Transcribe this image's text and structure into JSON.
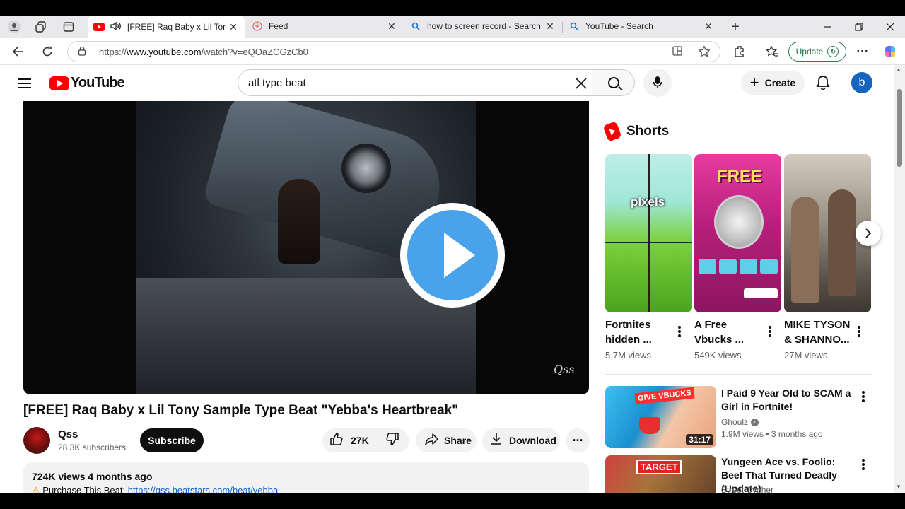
{
  "browser": {
    "tabs": [
      {
        "title": "[FREE] Raq Baby x Lil Tony Sa",
        "active": true
      },
      {
        "title": "Feed"
      },
      {
        "title": "how to screen record - Search"
      },
      {
        "title": "YouTube - Search"
      }
    ],
    "url_prefix": "https://",
    "url_host": "www.youtube.com",
    "url_path": "/watch?v=eQOaZCGzCb0",
    "update_label": "Update",
    "new_tab": "+"
  },
  "youtube": {
    "logo_text": "YouTube",
    "search_query": "atl type beat",
    "create_label": "Create",
    "avatar_letter": "b"
  },
  "video": {
    "title": "[FREE] Raq Baby x Lil Tony Sample Type Beat \"Yebba's Heartbreak\"",
    "watermark": "Qss",
    "channel_name": "Qss",
    "subscribers": "28.3K subscribers",
    "subscribe_label": "Subscribe",
    "likes": "27K",
    "share_label": "Share",
    "download_label": "Download",
    "views_age": "724K views  4 months ago",
    "desc_prefix": "Purchase This Beat: ",
    "desc_link": "https://qss.beatstars.com/beat/yebba-"
  },
  "shorts": {
    "heading": "Shorts",
    "items": [
      {
        "title": "Fortnites hidden ...",
        "views": "5.7M views",
        "thumb_text": "pixels"
      },
      {
        "title": "A Free Vbucks ...",
        "views": "549K views",
        "thumb_text": "FREE"
      },
      {
        "title": "MIKE TYSON & SHANNO...",
        "views": "27M views"
      }
    ]
  },
  "recommended": [
    {
      "title": "I Paid 9 Year Old to SCAM a Girl in Fortnite!",
      "channel": "Ghoulz",
      "meta": "1.9M views  •  3 months ago",
      "duration": "31:17",
      "thumb_text": "GIVE VBUCKS"
    },
    {
      "title": "Yungeen Ace vs. Foolio: Beef That Turned Deadly (Update)",
      "channel": "Street Cypher",
      "thumb_text": "TARGET"
    }
  ]
}
